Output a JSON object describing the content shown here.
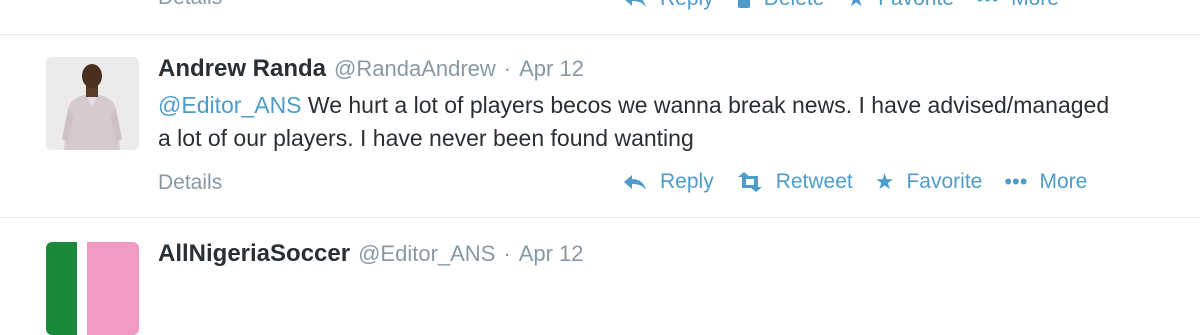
{
  "top_tweet": {
    "details_label": "Details",
    "actions": {
      "reply": "Reply",
      "delete": "Delete",
      "favorite": "Favorite",
      "more": "More"
    }
  },
  "main_tweet": {
    "author_name": "Andrew Randa",
    "handle": "@RandaAndrew",
    "separator": "·",
    "time": "Apr 12",
    "mention": "@Editor_ANS",
    "text": " We hurt a lot of players becos we wanna break news. I have advised/managed a lot of our players. I have never been found wanting",
    "details_label": "Details",
    "actions": {
      "reply": "Reply",
      "retweet": "Retweet",
      "favorite": "Favorite",
      "more": "More"
    }
  },
  "next_tweet": {
    "author_name": "AllNigeriaSoccer",
    "handle": "@Editor_ANS",
    "separator": "·",
    "time": "Apr 12"
  },
  "colors": {
    "link": "#4d9cc9",
    "muted": "#8899a6",
    "text": "#292f33",
    "divider": "#e1e8ed"
  }
}
